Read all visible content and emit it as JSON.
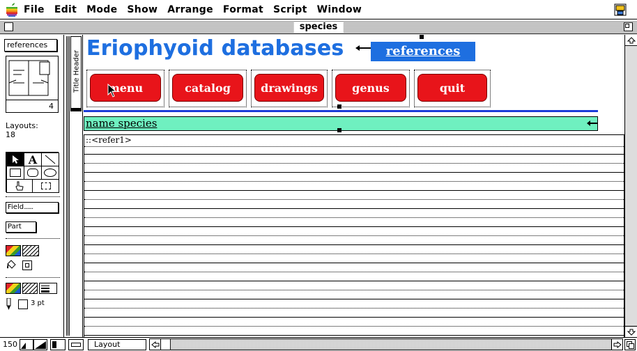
{
  "menubar": {
    "items": [
      "File",
      "Edit",
      "Mode",
      "Show",
      "Arrange",
      "Format",
      "Script",
      "Window"
    ]
  },
  "window": {
    "title": "species"
  },
  "left_panel": {
    "layout_popup": "references",
    "book_page": "4",
    "layouts_label": "Layouts:",
    "layouts_count": "18",
    "field_button": "Field",
    "part_button": "Part",
    "line_width": "3 pt",
    "zoom_level": "150",
    "mode_label": "Layout"
  },
  "part_label": "Title Header",
  "layout": {
    "title": "Eriophyoid databases",
    "reference_label": "references",
    "buttons": [
      {
        "label": "menu"
      },
      {
        "label": "catalog"
      },
      {
        "label": "drawings"
      },
      {
        "label": "genus"
      },
      {
        "label": "quit"
      }
    ],
    "name_field": "name species",
    "body_field": "::<refer1>"
  },
  "colors": {
    "title_blue": "#1e6fe0",
    "button_red": "#e8141a",
    "name_bar": "#6ff0c0",
    "rule_blue": "#1a3cd8"
  }
}
